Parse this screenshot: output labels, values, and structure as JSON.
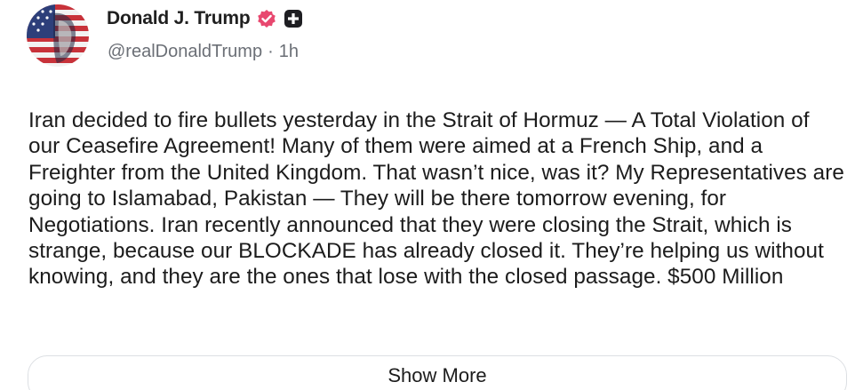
{
  "author": {
    "display_name": "Donald J. Trump",
    "handle": "@realDonaldTrump",
    "separator": "·",
    "timestamp": "1h",
    "avatar_icon": "avatar-flag-portrait",
    "verified_icon": "verified-badge-icon",
    "verified_color": "#e8486f",
    "badge_icon": "plus-square-icon"
  },
  "post": {
    "text": "Iran decided to fire bullets yesterday in the Strait of Hormuz — A Total Violation of our Ceasefire Agreement! Many of them were aimed at a French Ship, and a Freighter from the United Kingdom. That wasn’t nice, was it? My Representatives are going to Islamabad, Pakistan — They will be there tomorrow evening, for Negotiations. Iran recently announced that they were closing the Strait, which is strange, because our BLOCKADE has already closed it. They’re helping us without knowing, and they are the ones that lose with the closed passage. $500 Million"
  },
  "actions": {
    "show_more_label": "Show More"
  }
}
